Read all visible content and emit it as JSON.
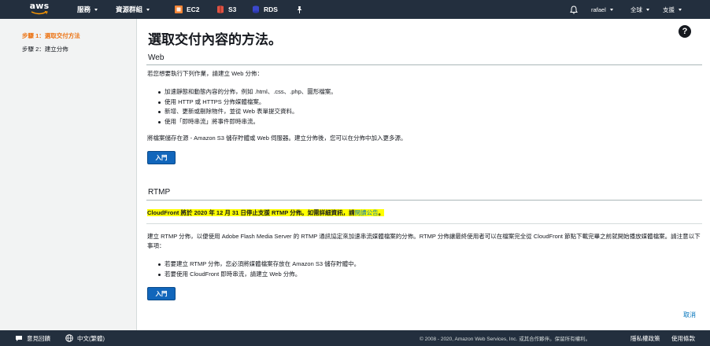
{
  "topnav": {
    "logo_text": "aws",
    "services": "服務",
    "resource_groups": "資源群組",
    "ec2": "EC2",
    "s3": "S3",
    "rds": "RDS",
    "user": "rafael",
    "region": "全球",
    "support": "支援",
    "colors": {
      "ec2": "#f58536",
      "s3": "#e05243",
      "rds": "#3b48cc"
    }
  },
  "sidebar": {
    "steps": [
      {
        "label": "步驟 1：選取交付方法"
      },
      {
        "label": "步驟 2：建立分佈"
      }
    ]
  },
  "main": {
    "title": "選取交付內容的方法。",
    "help_icon": "?",
    "web": {
      "heading": "Web",
      "intro": "若您想要執行下列作業，請建立 Web 分佈：",
      "bullets": [
        "加速靜態和動態內容的分佈，例如 .html、.css、.php、圖形檔案。",
        "使用 HTTP 或 HTTPS 分佈媒體檔案。",
        "新增、更新或刪除物件，並從 Web 表單提交資料。",
        "使用「即時串流」將事件即時串流。"
      ],
      "origin_note": "將檔案儲存在源 - Amazon S3 儲存貯體或 Web 伺服器。建立分佈後，您可以在分佈中加入更多源。",
      "button": "入門"
    },
    "rtmp": {
      "heading": "RTMP",
      "notice": "CloudFront 將於 2020 年 12 月 31 日停止支援 RTMP 分佈。如需詳細資訊，請",
      "notice_link": "閱讀公告",
      "notice_end": "。",
      "description": "建立 RTMP 分佈，以便使用 Adobe Flash Media Server 的 RTMP 通訊協定來加速串流媒體檔案的分佈。RTMP 分佈讓最終使用者可以在檔案完全從 CloudFront 節點下載完畢之前就開始播放媒體檔案。請注意以下事項：",
      "bullets": [
        "若要建立 RTMP 分佈，您必須將媒體檔案存放在 Amazon S3 儲存貯體中。",
        "若要使用 CloudFront 即時串流，請建立 Web 分佈。"
      ],
      "button": "入門"
    },
    "cancel": "取消"
  },
  "footer": {
    "feedback": "意見回饋",
    "language": "中文(繁體)",
    "copyright": "© 2008 - 2020, Amazon Web Services, Inc. 或其合作夥伴。保留所有權利。",
    "privacy": "隱私權政策",
    "terms": "使用條款"
  }
}
